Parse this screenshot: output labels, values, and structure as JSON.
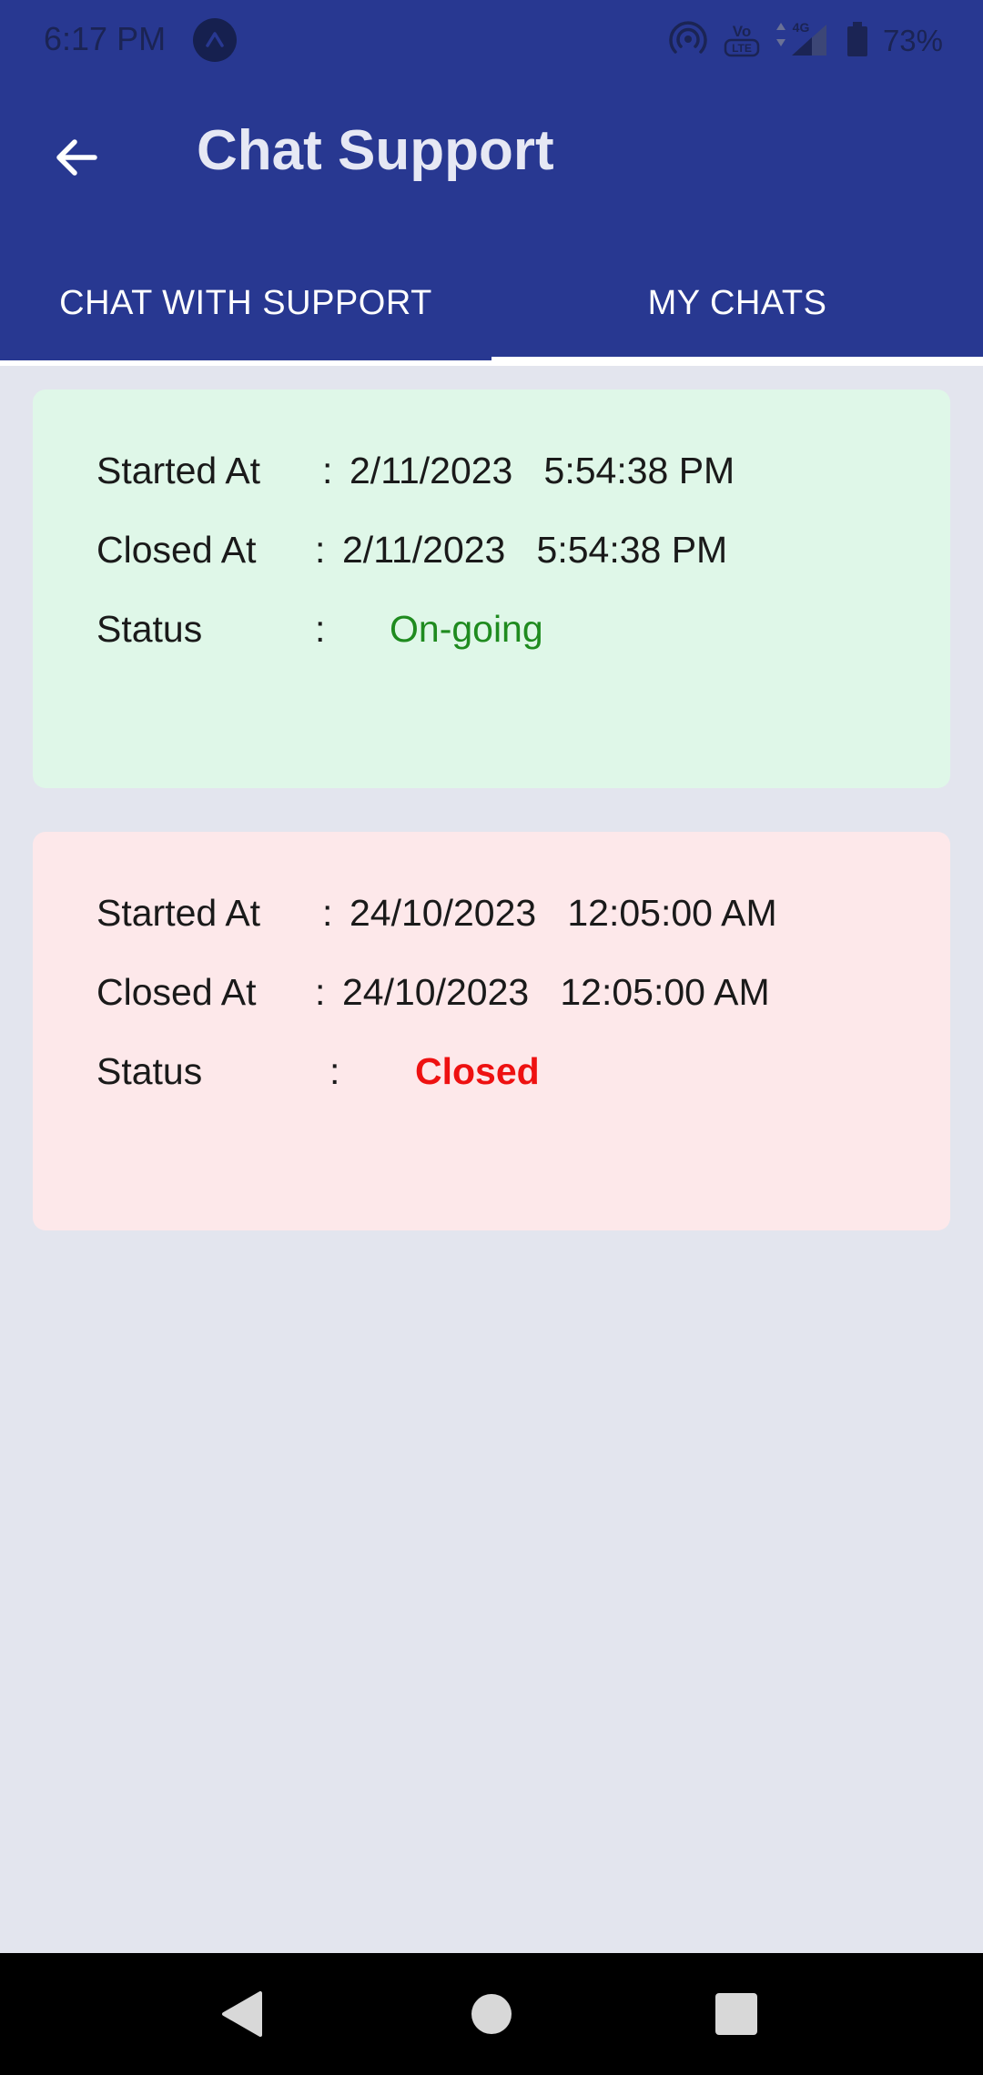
{
  "status_bar": {
    "time": "6:17 PM",
    "battery": "73%",
    "icons": [
      "app-notification-icon",
      "hotspot-icon",
      "volte-icon",
      "signal-4g-icon",
      "battery-icon"
    ]
  },
  "toolbar": {
    "title": "Chat Support",
    "back_icon": "arrow-left-icon"
  },
  "tabs": [
    {
      "label": "CHAT WITH SUPPORT",
      "selected": false
    },
    {
      "label": "MY CHATS",
      "selected": true
    }
  ],
  "chats": [
    {
      "started_label": "Started At",
      "started_value": "2/11/2023   5:54:38 PM",
      "closed_label": "Closed At",
      "closed_value": "2/11/2023   5:54:38 PM",
      "status_label": "Status",
      "status_value": "On-going",
      "colon": ":"
    },
    {
      "started_label": "Started At",
      "started_value": "24/10/2023   12:05:00 AM",
      "closed_label": "Closed At",
      "closed_value": "24/10/2023   12:05:00 AM",
      "status_label": "Status",
      "status_value": "Closed",
      "colon": ":"
    }
  ],
  "nav_bar": {
    "icons": [
      "back-triangle-icon",
      "home-circle-icon",
      "recents-square-icon"
    ]
  },
  "colors": {
    "header": "#283891",
    "background": "#e3e5ee",
    "card_ongoing": "#dff7e8",
    "card_closed": "#fde8ea",
    "status_ongoing": "#1f8b1f",
    "status_closed": "#ee1111"
  }
}
